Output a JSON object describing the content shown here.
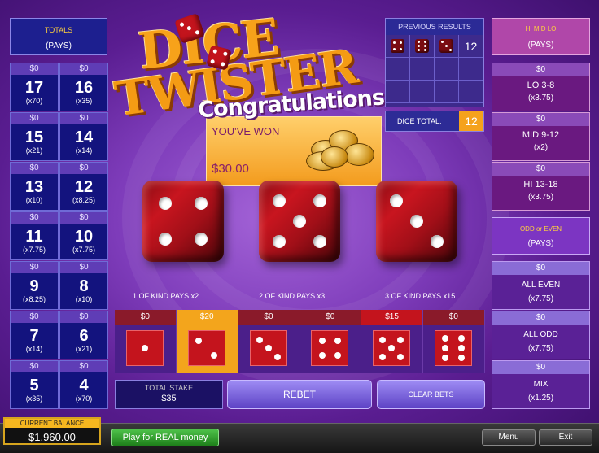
{
  "logo": {
    "line1": "DICE",
    "line2": "TWISTER"
  },
  "totals": {
    "title": "TOTALS",
    "subtitle": "(PAYS)",
    "cells": [
      {
        "bet": "$0",
        "total": "17",
        "pays": "(x70)"
      },
      {
        "bet": "$0",
        "total": "16",
        "pays": "(x35)"
      },
      {
        "bet": "$0",
        "total": "15",
        "pays": "(x21)"
      },
      {
        "bet": "$0",
        "total": "14",
        "pays": "(x14)"
      },
      {
        "bet": "$0",
        "total": "13",
        "pays": "(x10)"
      },
      {
        "bet": "$0",
        "total": "12",
        "pays": "(x8.25)"
      },
      {
        "bet": "$0",
        "total": "11",
        "pays": "(x7.75)"
      },
      {
        "bet": "$0",
        "total": "10",
        "pays": "(x7.75)"
      },
      {
        "bet": "$0",
        "total": "9",
        "pays": "(x8.25)"
      },
      {
        "bet": "$0",
        "total": "8",
        "pays": "(x10)"
      },
      {
        "bet": "$0",
        "total": "7",
        "pays": "(x14)"
      },
      {
        "bet": "$0",
        "total": "6",
        "pays": "(x21)"
      },
      {
        "bet": "$0",
        "total": "5",
        "pays": "(x35)"
      },
      {
        "bet": "$0",
        "total": "4",
        "pays": "(x70)"
      }
    ]
  },
  "win": {
    "congrats": "Congratulations!",
    "label": "YOU'VE WON",
    "amount": "$30.00"
  },
  "previous": {
    "title": "PREVIOUS RESULTS",
    "latest_total": "12",
    "dice_total_label": "DICE TOTAL:",
    "dice_total": "12"
  },
  "rolled_dice": [
    4,
    5,
    3
  ],
  "kind_labels": [
    "1 OF KIND PAYS x2",
    "2 OF KIND PAYS x3",
    "3 OF KIND PAYS x15"
  ],
  "face_bets": [
    {
      "amount": "$0",
      "face": 1
    },
    {
      "amount": "$20",
      "face": 2
    },
    {
      "amount": "$0",
      "face": 3
    },
    {
      "amount": "$0",
      "face": 4
    },
    {
      "amount": "$15",
      "face": 5
    },
    {
      "amount": "$0",
      "face": 6
    }
  ],
  "stake": {
    "label": "TOTAL STAKE",
    "value": "$35"
  },
  "buttons": {
    "rebet": "REBET",
    "clear": "CLEAR BETS"
  },
  "himidlo": {
    "title": "HI MID LO",
    "subtitle": "(PAYS)",
    "rows": [
      {
        "bet": "$0",
        "label": "LO 3-8",
        "pays": "(x3.75)"
      },
      {
        "bet": "$0",
        "label": "MID 9-12",
        "pays": "(x2)"
      },
      {
        "bet": "$0",
        "label": "HI 13-18",
        "pays": "(x3.75)"
      }
    ]
  },
  "oddeven": {
    "title": "ODD or EVEN",
    "subtitle": "(PAYS)",
    "rows": [
      {
        "bet": "$0",
        "label": "ALL EVEN",
        "pays": "(x7.75)"
      },
      {
        "bet": "$0",
        "label": "ALL ODD",
        "pays": "(x7.75)"
      },
      {
        "bet": "$0",
        "label": "MIX",
        "pays": "(x1.25)"
      }
    ]
  },
  "balance": {
    "label": "CURRENT BALANCE",
    "value": "$1,960.00"
  },
  "footer": {
    "real_money": "Play for REAL money",
    "menu": "Menu",
    "exit": "Exit"
  },
  "colors": {
    "accent": "#f5a21c",
    "die_red": "#c4141d",
    "panel_blue": "#13137e"
  }
}
